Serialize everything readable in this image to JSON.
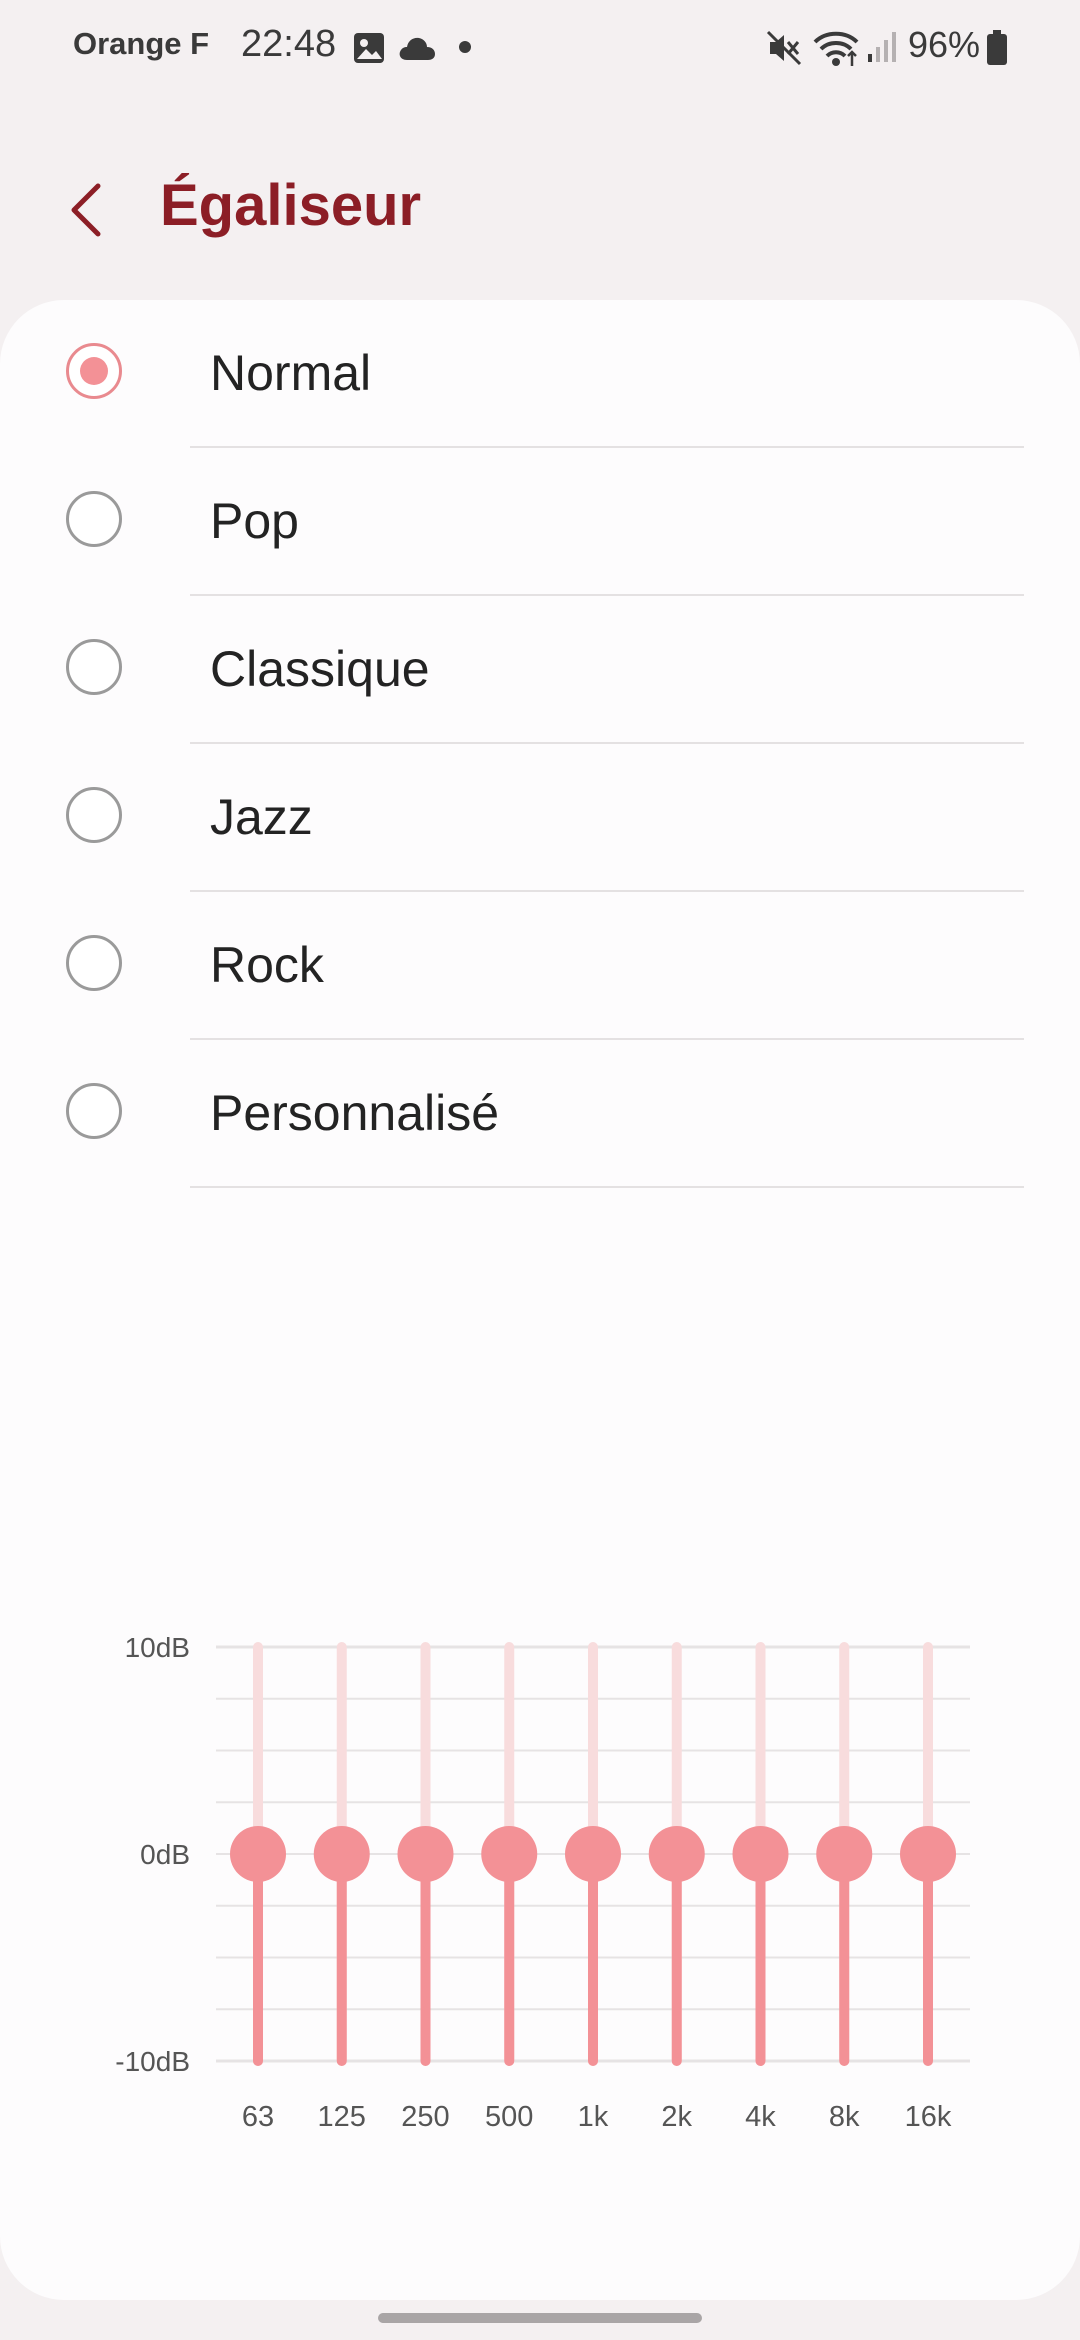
{
  "status_bar": {
    "carrier": "Orange F",
    "time": "22:48",
    "battery": "96%",
    "icons": [
      "gallery-icon",
      "cloud-icon",
      "dot-icon",
      "mute-icon",
      "wifi-icon",
      "signal-icon",
      "battery-icon"
    ]
  },
  "header": {
    "title": "Égaliseur",
    "back_icon": "chevron-left-icon"
  },
  "presets": {
    "selected": "Normal",
    "items": [
      {
        "label": "Normal",
        "checked": true
      },
      {
        "label": "Pop",
        "checked": false
      },
      {
        "label": "Classique",
        "checked": false
      },
      {
        "label": "Jazz",
        "checked": false
      },
      {
        "label": "Rock",
        "checked": false
      },
      {
        "label": "Personnalisé",
        "checked": false
      }
    ]
  },
  "colors": {
    "accent": "#8c1e26",
    "slider_active": "#f39196",
    "slider_track": "#f8dcdd",
    "radio_checked": "#f39196"
  },
  "chart_data": {
    "type": "bar",
    "y_tick_labels": [
      "10dB",
      "0dB",
      "-10dB"
    ],
    "ylim": [
      -10,
      10
    ],
    "categories": [
      "63",
      "125",
      "250",
      "500",
      "1k",
      "2k",
      "4k",
      "8k",
      "16k"
    ],
    "values": [
      0,
      0,
      0,
      0,
      0,
      0,
      0,
      0,
      0
    ],
    "grid": true
  }
}
